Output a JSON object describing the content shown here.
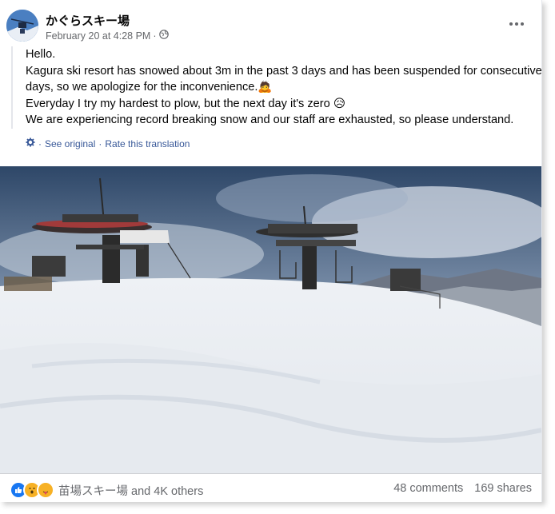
{
  "post": {
    "page_name": "かぐらスキー場",
    "timestamp": "February 20 at 4:28 PM",
    "separator": "·",
    "privacy_icon": "globe-icon",
    "more_icon": "more-dots-icon",
    "lines": [
      "Hello.",
      "Kagura ski resort has snowed about 3m in the past 3 days and has been suspended for consecutive days, so we apologize for the inconvenience.🙇",
      "Everyday I try my hardest to plow, but the next day it's zero 😥",
      "We are experiencing record breaking snow and our staff are exhausted, so please understand."
    ],
    "translation": {
      "icon": "gear-icon",
      "see_original": "See original",
      "separator": "·",
      "rate": "Rate this translation"
    }
  },
  "photo": {
    "description_icon": "ski-lift-snow-photo"
  },
  "footer": {
    "reaction_icons": [
      "like-icon",
      "wow-icon",
      "care-icon"
    ],
    "reactors": "苗場スキー場 and 4K others",
    "comments": "48 comments",
    "shares": "169 shares"
  },
  "colors": {
    "link": "#385898",
    "secondary_text": "#65676b",
    "like_blue": "#1877f2",
    "wow_yellow": "#f7b125"
  }
}
